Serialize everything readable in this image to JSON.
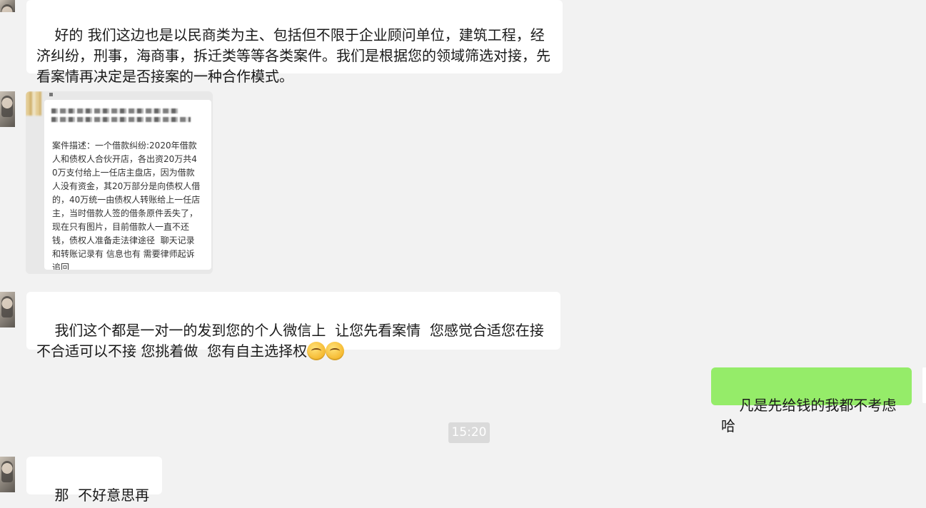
{
  "messages": [
    {
      "id": "m1",
      "text": "好的 我们这边也是以民商类为主、包括但不限于企业顾问单位，建筑工程，经济纠纷，刑事，海商事，拆迁类等等各类案件。我们是根据您的领域筛选对接，先看案情再决定是否接案的一种合作模式。"
    },
    {
      "id": "m2",
      "case_text": "案件描述：一个借款纠纷:2020年借款人和债权人合伙开店，各出资20万共40万支付给上一任店主盘店，因为借款人没有资金，其20万部分是向债权人借的，40万统一由债权人转账给上一任店主，当时借款人签的借条原件丢失了，现在只有图片，目前借款人一直不还钱，债权人准备走法律途径  聊天记录和转账记录有 信息也有 需要律师起诉追回"
    },
    {
      "id": "m3",
      "text": "我们这个都是一对一的发到您的个人微信上  让您先看案情  您感觉合适您在接 不合适可以不接 您挑着做  您有自主选择权"
    },
    {
      "id": "m4",
      "text": "凡是先给钱的我都不考虑哈"
    },
    {
      "id": "m5",
      "text": "那  不好意思再见"
    }
  ],
  "timestamp": "15:20",
  "colors": {
    "background": "#f2f2f2",
    "bubble_incoming": "#ffffff",
    "bubble_outgoing": "#95ec69",
    "timestamp_bg": "#dadada"
  },
  "icons": {
    "emoji": "smirk-face-emoji"
  }
}
